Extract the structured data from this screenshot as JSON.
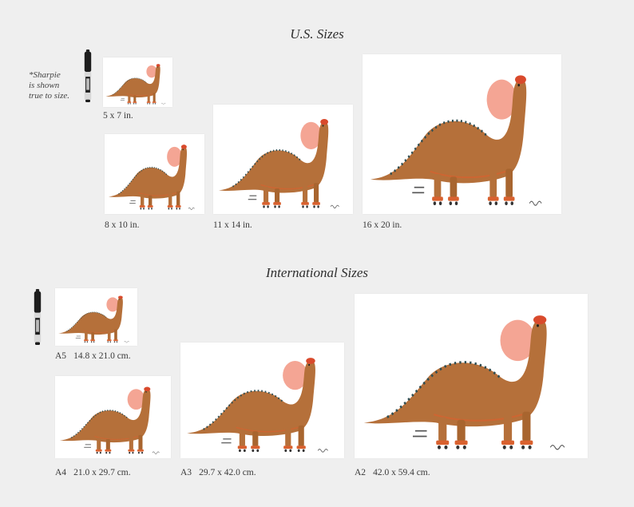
{
  "us": {
    "heading": "U.S. Sizes",
    "note_lines": [
      "*Sharpie",
      "is shown",
      "true to size."
    ],
    "sizes": [
      {
        "label": "5 x 7 in."
      },
      {
        "label": "8 x 10 in."
      },
      {
        "label": "11 x 14 in."
      },
      {
        "label": "16 x 20 in."
      }
    ]
  },
  "intl": {
    "heading": "International Sizes",
    "sizes": [
      {
        "code": "A5",
        "dims": "14.8 x 21.0 cm."
      },
      {
        "code": "A4",
        "dims": "21.0 x 29.7 cm."
      },
      {
        "code": "A3",
        "dims": "29.7 x 42.0 cm."
      },
      {
        "code": "A2",
        "dims": "42.0 x 59.4 cm."
      }
    ]
  },
  "colors": {
    "background": "#efefef",
    "paper": "#ffffff",
    "dino_body": "#b5703a",
    "bubble": "#f4a594",
    "cap": "#d94a2c"
  },
  "icons": {
    "print": "dinosaur-art-print",
    "marker": "sharpie-marker-icon"
  }
}
